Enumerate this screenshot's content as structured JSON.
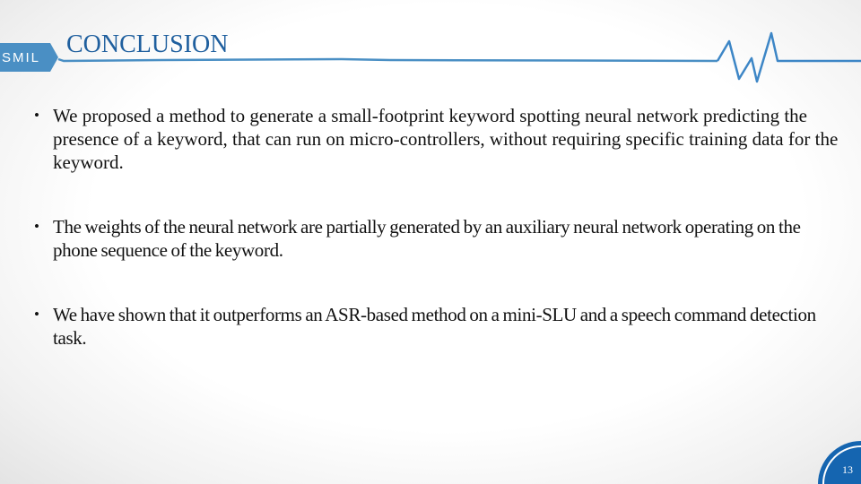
{
  "slide": {
    "badge": "SMIL",
    "title": "CONCLUSION",
    "bullets": [
      {
        "symbol": "•",
        "text": "We proposed a method to generate a small-footprint keyword spotting neural network predicting the presence of a keyword, that can run on micro-controllers, without requiring specific training data for the keyword."
      },
      {
        "symbol": "•",
        "text": "The weights of the neural network are partially generated by an auxiliary neural network operating on the phone sequence of the keyword."
      },
      {
        "symbol": "•",
        "text": "We have shown that it outperforms an ASR-based method on a mini-SLU and a speech command detection task."
      }
    ],
    "page_number": "13"
  },
  "colors": {
    "accent": "#4a8fc4",
    "title": "#1f5f9e",
    "page_badge": "#1565b0",
    "text": "#111111"
  },
  "icons": {
    "header_wave": "waveform-icon"
  }
}
